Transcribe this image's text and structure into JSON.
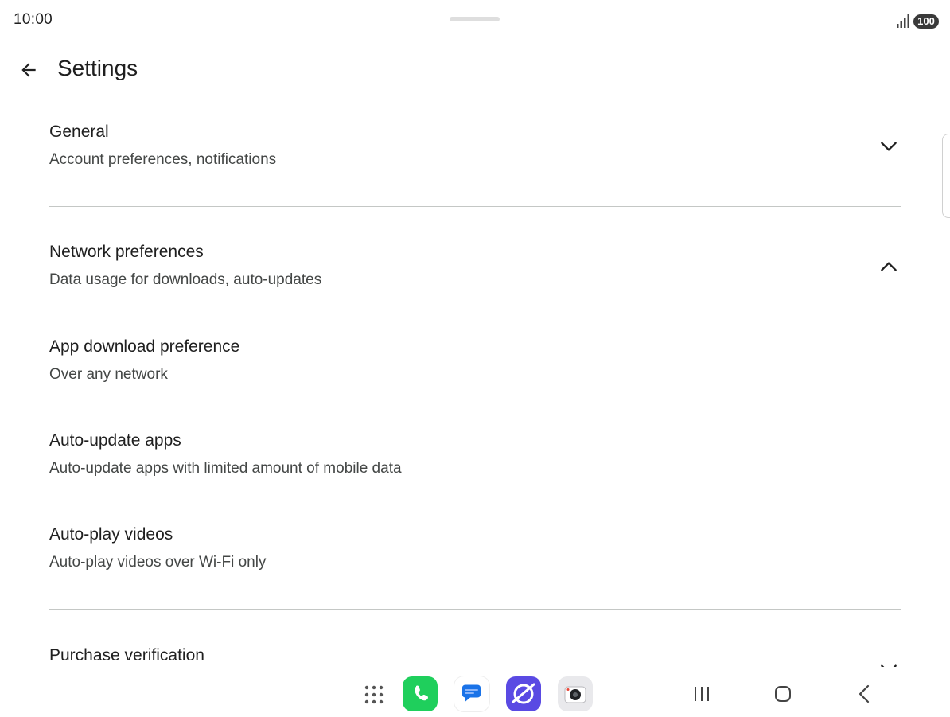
{
  "status_bar": {
    "time": "10:00",
    "battery": "100"
  },
  "app_bar": {
    "title": "Settings"
  },
  "sections": [
    {
      "title": "General",
      "subtitle": "Account preferences, notifications",
      "expanded": false
    },
    {
      "title": "Network preferences",
      "subtitle": "Data usage for downloads, auto-updates",
      "expanded": true
    },
    {
      "title": "Purchase verification",
      "expanded": false
    }
  ],
  "network_items": [
    {
      "title": "App download preference",
      "subtitle": "Over any network"
    },
    {
      "title": "Auto-update apps",
      "subtitle": "Auto-update apps with limited amount of mobile data"
    },
    {
      "title": "Auto-play videos",
      "subtitle": "Auto-play videos over Wi-Fi only"
    }
  ],
  "taskbar": {
    "apps": [
      "apps-grid-icon",
      "phone-icon",
      "messages-icon",
      "internet-icon",
      "camera-icon"
    ],
    "nav": [
      "recents-icon",
      "home-icon",
      "back-nav-icon"
    ]
  },
  "colors": {
    "text_primary": "#1f1f1f",
    "text_secondary": "#444746",
    "divider": "#c4c7c5",
    "phone_green": "#1fcf5c",
    "internet_purple": "#5a4ae3"
  }
}
